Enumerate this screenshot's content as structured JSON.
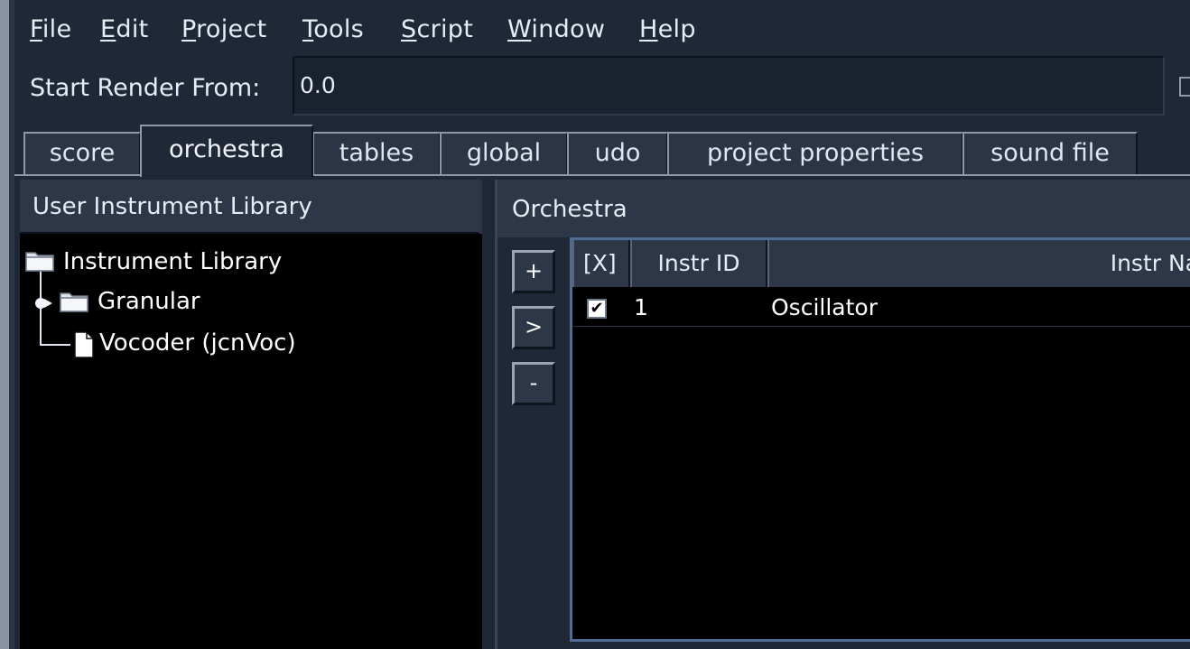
{
  "menu": {
    "file": {
      "mnemonic": "F",
      "rest": "ile"
    },
    "edit": {
      "mnemonic": "E",
      "rest": "dit"
    },
    "project": {
      "mnemonic": "P",
      "rest": "roject"
    },
    "tools": {
      "mnemonic": "T",
      "rest": "ools"
    },
    "script": {
      "mnemonic": "S",
      "rest": "cript"
    },
    "window": {
      "mnemonic": "W",
      "rest": "indow"
    },
    "help": {
      "mnemonic": "H",
      "rest": "elp"
    }
  },
  "render": {
    "label": "Start Render From:",
    "value": "0.0"
  },
  "tabs": [
    {
      "label": "score"
    },
    {
      "label": "orchestra"
    },
    {
      "label": "tables"
    },
    {
      "label": "global"
    },
    {
      "label": "udo"
    },
    {
      "label": "project properties"
    },
    {
      "label": "sound file"
    }
  ],
  "active_tab": "orchestra",
  "library": {
    "title": "User Instrument Library",
    "tree": [
      {
        "label": "Instrument Library",
        "type": "folder",
        "icon": "folder-icon"
      },
      {
        "label": "Granular",
        "type": "folder",
        "icon": "folder-icon",
        "collapsed": true
      },
      {
        "label": "Vocoder (jcnVoc)",
        "type": "instrument",
        "icon": "document-icon"
      }
    ]
  },
  "orchestra": {
    "title": "Orchestra",
    "buttons": {
      "add": "+",
      "send": ">",
      "remove": "-"
    },
    "columns": [
      "[X]",
      "Instr ID",
      "Instr Na"
    ],
    "rows": [
      {
        "enabled": true,
        "id": "1",
        "name": "Oscillator"
      }
    ]
  },
  "colors": {
    "background": "#1f2837",
    "panel_header": "#2d3748",
    "content": "#000000",
    "table_border": "#4b6d96"
  }
}
